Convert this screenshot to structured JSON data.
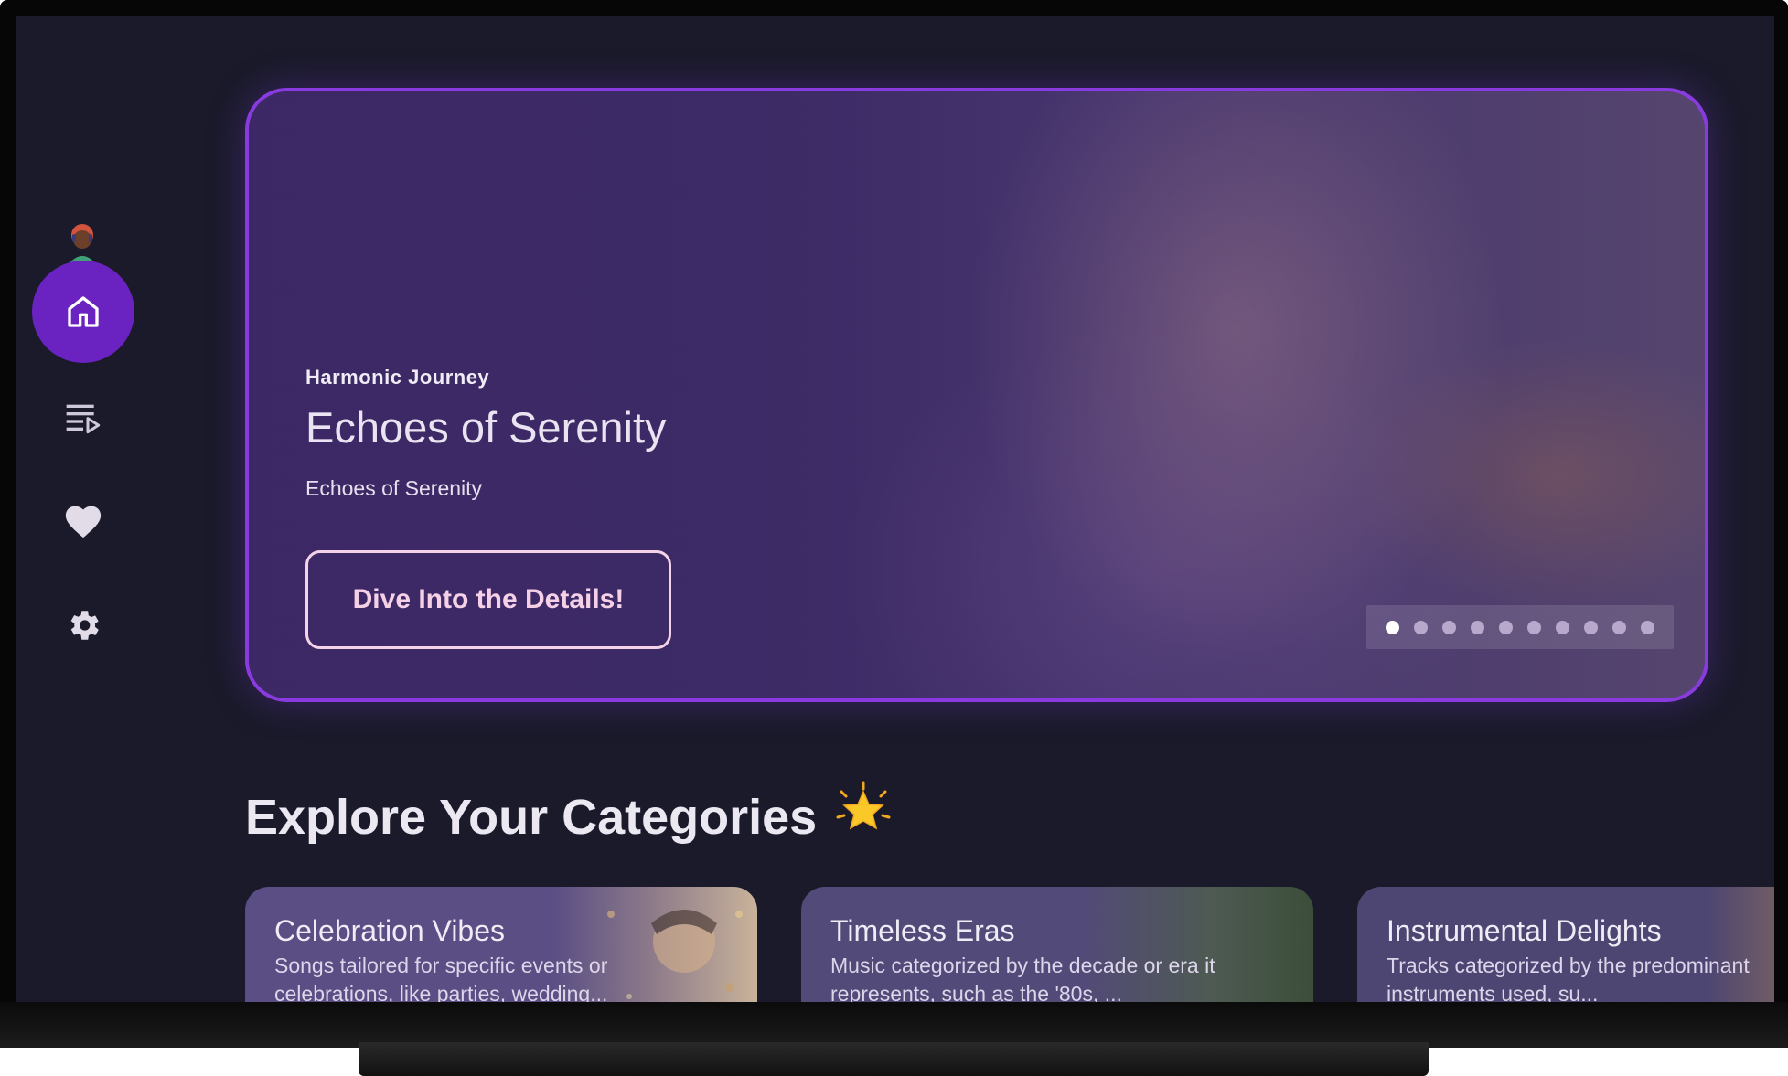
{
  "sidebar": {
    "items": [
      {
        "icon": "home-icon",
        "active": true
      },
      {
        "icon": "playlist-play-icon",
        "active": false
      },
      {
        "icon": "heart-icon",
        "active": false
      },
      {
        "icon": "gear-icon",
        "active": false
      }
    ]
  },
  "hero": {
    "kicker": "Harmonic Journey",
    "title": "Echoes of Serenity",
    "subtitle": "Echoes of Serenity",
    "button_label": "Dive Into the Details!",
    "pager": {
      "count": 10,
      "active_index": 0
    }
  },
  "categories": {
    "heading": "Explore Your Categories",
    "heading_icon": "star-icon",
    "items": [
      {
        "title": "Celebration Vibes",
        "description": "Songs tailored for specific events or celebrations, like parties, wedding..."
      },
      {
        "title": "Timeless Eras",
        "description": "Music categorized by the decade or era it represents, such as the '80s, ..."
      },
      {
        "title": "Instrumental Delights",
        "description": "Tracks categorized by the predominant instruments used, su..."
      }
    ]
  },
  "colors": {
    "accent": "#6a22c0",
    "hero_border": "#8a3be0",
    "background": "#1a1a2a",
    "button_text": "#f6d0e6"
  }
}
